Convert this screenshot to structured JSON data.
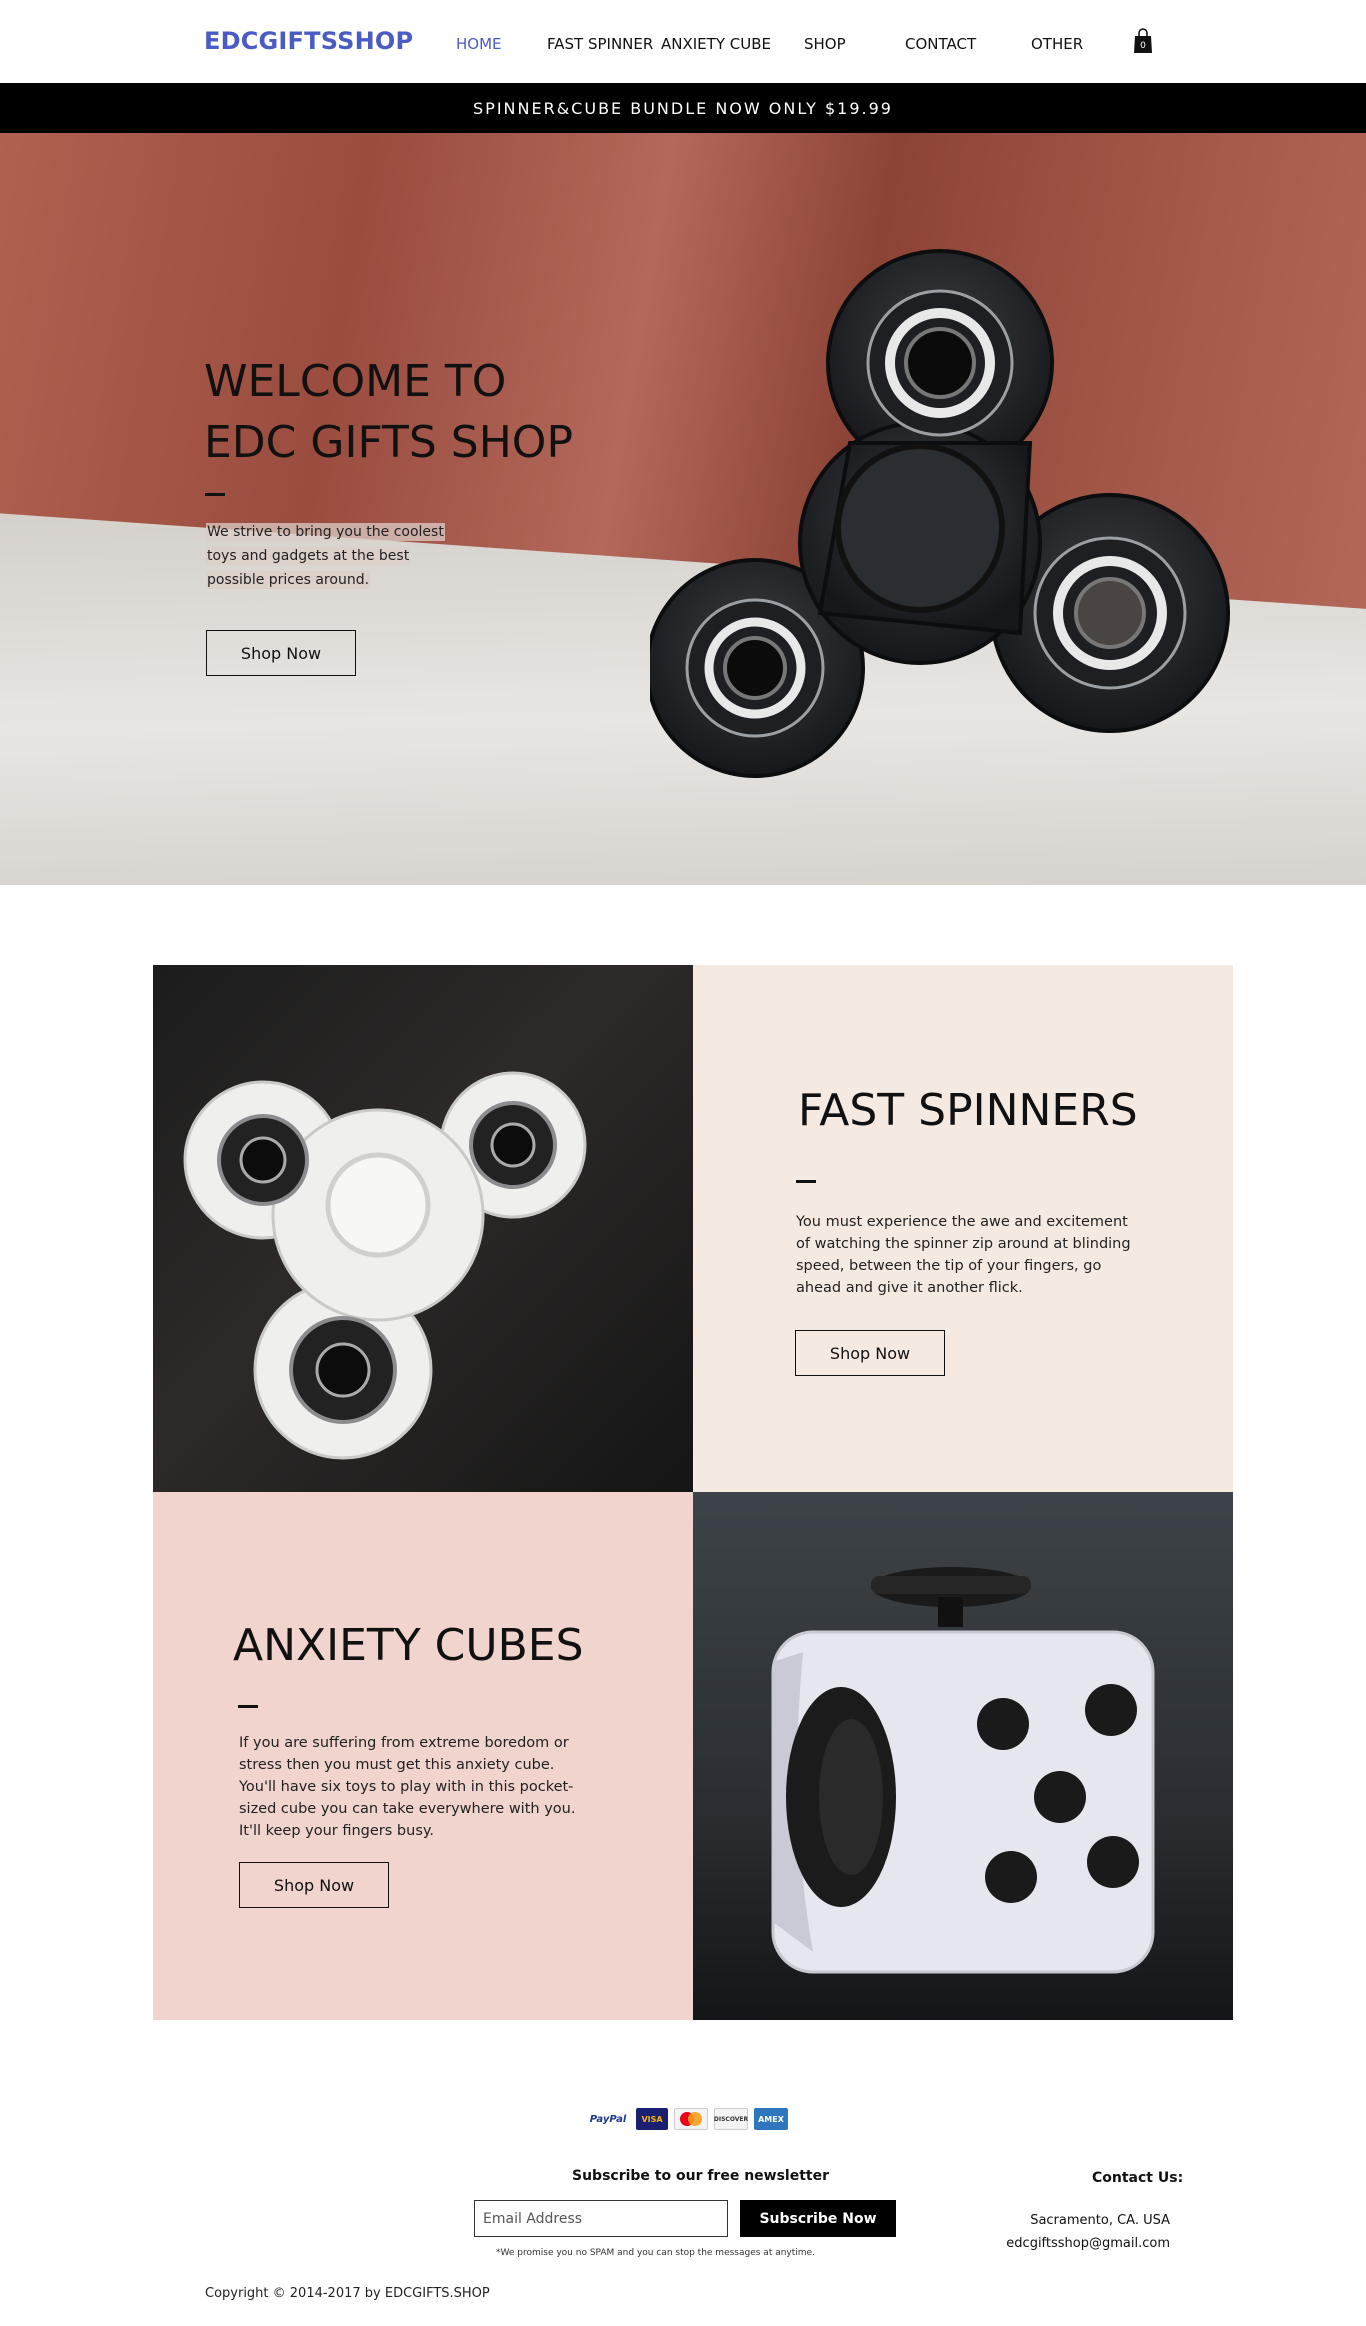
{
  "header": {
    "logo": "EDCGIFTSSHOP",
    "nav": [
      "HOME",
      "FAST SPINNER",
      "ANXIETY CUBE",
      "SHOP",
      "CONTACT",
      "OTHER"
    ],
    "active_nav": "HOME",
    "cart_count": "0"
  },
  "announcement": "SPINNER&CUBE BUNDLE NOW ONLY $19.99",
  "hero": {
    "title_line1": "WELCOME TO",
    "title_line2": "EDC GIFTS SHOP",
    "text": "We strive to bring you the coolest toys and gadgets at the best possible prices around.",
    "button": "Shop Now"
  },
  "spinners": {
    "title": "FAST SPINNERS",
    "text": "You must experience the awe and excitement of watching the spinner zip around at blinding speed, between the tip of your fingers, go ahead and give it another flick.",
    "button": "Shop Now"
  },
  "cubes": {
    "title": "ANXIETY CUBES",
    "text": "If you are suffering from extreme boredom or stress then you must get this anxiety cube. You'll have six toys to play with in this pocket-sized cube you can take everywhere with you. It'll keep your fingers busy.",
    "button": "Shop Now"
  },
  "footer": {
    "payments": [
      "PayPal",
      "VISA",
      "MasterCard",
      "DISCOVER",
      "AMEX"
    ],
    "newsletter_title": "Subscribe to our free newsletter",
    "email_placeholder": "Email Address",
    "subscribe_button": "Subscribe Now",
    "spam_note": "*We promise you no SPAM and you can stop the messages at anytime.",
    "contact_title": "Contact Us:",
    "address": "Sacramento, CA. USA",
    "email": "edcgiftsshop@gmail.com",
    "copyright": "Copyright © 2014-2017 by EDCGIFTS.SHOP"
  },
  "colors": {
    "brand": "#4b5bc4",
    "spinner_tile_bg": "#f4eae2",
    "cube_tile_bg": "#f0d4cd",
    "announcement_bg": "#000000"
  }
}
